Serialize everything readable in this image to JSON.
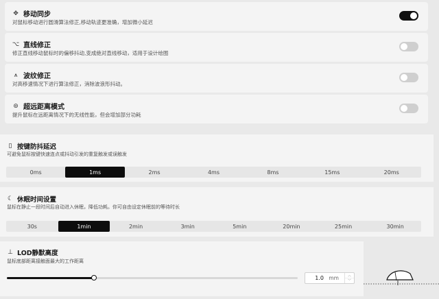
{
  "settings": [
    {
      "icon": "✥",
      "title": "移动同步",
      "desc": "对鼠标移动进行圆滑算法修正,移动轨迹更准确，增加微小延迟",
      "enabled": true
    },
    {
      "icon": "⌥",
      "title": "直线修正",
      "desc": "修正直线移动鼠标时的偏移抖动,变成绝对直线移动，适用于设计绘图",
      "enabled": false
    },
    {
      "icon": "⩚",
      "title": "波纹修正",
      "desc": "对高移速情况下进行算法修正，消除波浪形抖动。",
      "enabled": false
    },
    {
      "icon": "⊚",
      "title": "超远距离模式",
      "desc": "提升鼠标在远距离情况下的无线性能，但会增加部分功耗",
      "enabled": false
    }
  ],
  "debounce": {
    "icon": "▯",
    "title": "按键防抖延迟",
    "desc": "可避免鼠标按键快速连点或抖动引发的重复触发或误触发",
    "options": [
      "0ms",
      "1ms",
      "2ms",
      "4ms",
      "8ms",
      "15ms",
      "20ms"
    ],
    "selected": "1ms"
  },
  "sleep": {
    "icon": "☾",
    "title": "休眠时间设置",
    "desc": "鼠标在静止一段时间后自动进入休眠，降低功耗。你可自由设定休眠前的等待时长",
    "options": [
      "30s",
      "1min",
      "2min",
      "3min",
      "5min",
      "20min",
      "25min",
      "30min"
    ],
    "selected": "1min"
  },
  "lod": {
    "icon": "⊥",
    "title": "LOD静默高度",
    "desc": "鼠标底部距离接触面最大的工作距离",
    "value": "1.0",
    "unit": "mm",
    "slider_fraction": 0.3,
    "step_up": "︿",
    "step_down": "﹀"
  }
}
